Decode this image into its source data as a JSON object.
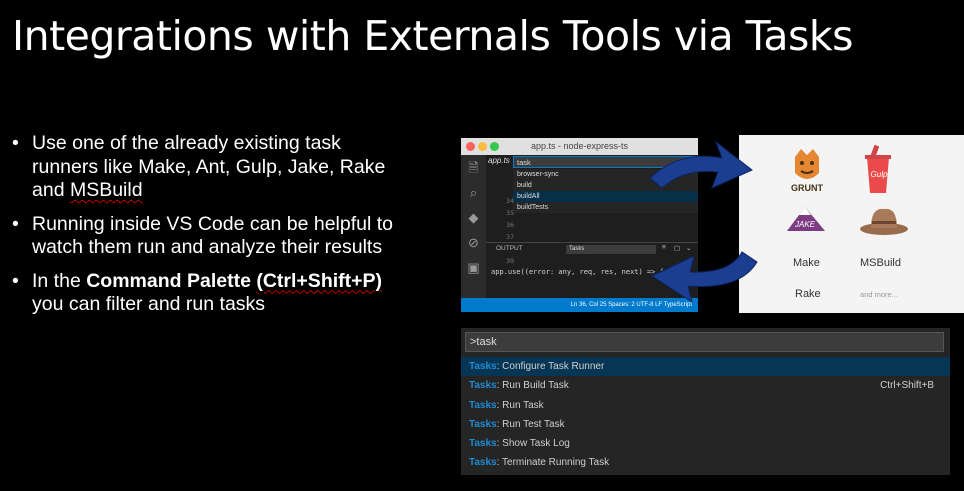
{
  "slide": {
    "title": "Integrations with Externals Tools via Tasks",
    "bullets": {
      "b1_a": "Use one of the already existing task runners like Make, Ant, Gulp, Jake, Rake and ",
      "b1_b": "MSBuild",
      "b2": "Running inside VS Code can be helpful to watch them run and analyze their results",
      "b3_a": "In the ",
      "b3_b": "Command Palette ",
      "b3_c": "(Ctrl+Shift+P)",
      "b3_d": " you can filter and run tasks"
    }
  },
  "vscode": {
    "window_title": "app.ts - node-express-ts",
    "file_tab": "app.ts",
    "command_input": "task",
    "dropdown": [
      "browser-sync",
      "build",
      "buildAll",
      "buildTests"
    ],
    "gutter": [
      "34",
      "35",
      "36",
      "37",
      "38",
      "39"
    ],
    "code_line": "app.use((error: any, req, res, next) => {",
    "output_label": "OUTPUT",
    "output_select": "Tasks",
    "status": "Ln 36, Col 25   Spaces: 2   UTF-8   LF   TypeScript",
    "colors": {
      "accent": "#007acc"
    }
  },
  "runners": {
    "grunt_label": "GRUNT",
    "gulp_label": "Gulp",
    "jake_label": "JAKE",
    "make": "Make",
    "msbuild": "MSBuild",
    "rake": "Rake",
    "more": "and more..."
  },
  "palette": {
    "input": ">task",
    "items": [
      {
        "hl": "Tasks",
        "rest": ": Configure Task Runner",
        "kb": ""
      },
      {
        "hl": "Tasks",
        "rest": ": Run Build Task",
        "kb": "Ctrl+Shift+B"
      },
      {
        "hl": "Tasks",
        "rest": ": Run Task",
        "kb": ""
      },
      {
        "hl": "Tasks",
        "rest": ": Run Test Task",
        "kb": ""
      },
      {
        "hl": "Tasks",
        "rest": ": Show Task Log",
        "kb": ""
      },
      {
        "hl": "Tasks",
        "rest": ": Terminate Running Task",
        "kb": ""
      }
    ],
    "colors": {
      "highlight": "#1f8ad2",
      "selected": "#073655"
    }
  }
}
